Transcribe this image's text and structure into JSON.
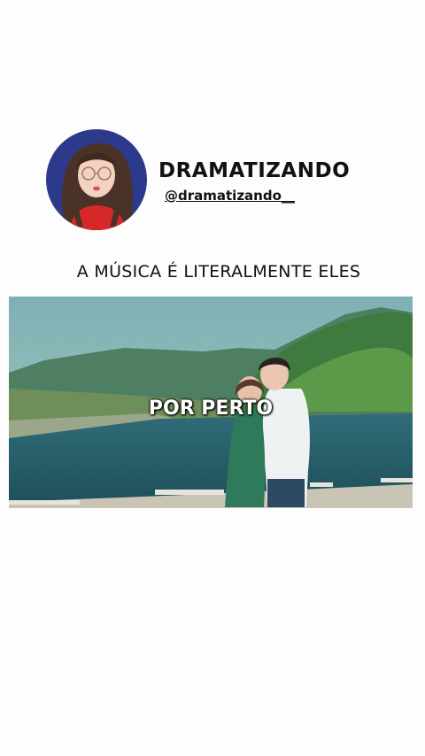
{
  "profile": {
    "name": "DRAMATIZANDO",
    "handle": "@dramatizando__"
  },
  "post": {
    "caption": "A MÚSICA É LITERALMENTE ELES"
  },
  "video": {
    "subtitle": "POR PERTO"
  },
  "colors": {
    "avatar_ring": "#2d3a8c",
    "text": "#111111",
    "subtitle_text": "#ffffff"
  }
}
